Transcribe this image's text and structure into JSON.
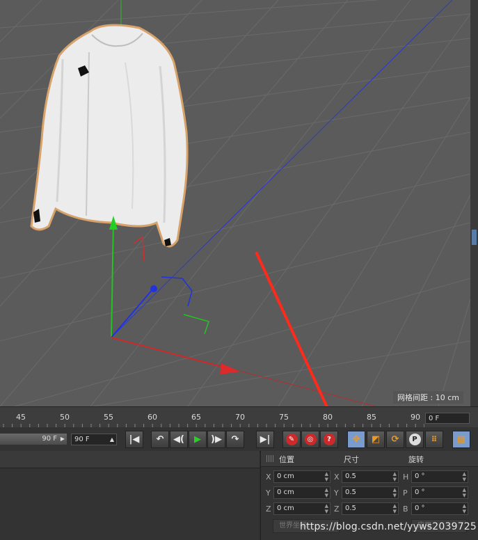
{
  "viewport": {
    "grid_spacing_label": "网格间距 : 10 cm"
  },
  "timeline": {
    "ticks": [
      "45",
      "50",
      "55",
      "60",
      "65",
      "70",
      "75",
      "80",
      "85",
      "90"
    ],
    "current_frame": "0 F",
    "range_end_label": "90 F",
    "end_frame": "90 F"
  },
  "transport": {
    "buttons": [
      {
        "name": "go-to-start-button",
        "glyph": "|◀"
      },
      {
        "name": "step-back-key-button",
        "glyph": "⟲"
      },
      {
        "name": "step-back-frame-button",
        "glyph": "◀("
      },
      {
        "name": "play-button",
        "glyph": "▶"
      },
      {
        "name": "step-forward-frame-button",
        "glyph": ")▶"
      },
      {
        "name": "step-forward-key-button",
        "glyph": "⟳"
      },
      {
        "name": "go-to-end-button",
        "glyph": "▶|"
      }
    ]
  },
  "attributes": {
    "headers": {
      "position": "位置",
      "size": "尺寸",
      "rotation": "旋转"
    },
    "rows": [
      {
        "pos_axis": "X",
        "pos_value": "0 cm",
        "size_axis": "X",
        "size_value": "0.5",
        "rot_axis": "H",
        "rot_value": "0 °"
      },
      {
        "pos_axis": "Y",
        "pos_value": "0 cm",
        "size_axis": "Y",
        "size_value": "0.5",
        "rot_axis": "P",
        "rot_value": "0 °"
      },
      {
        "pos_axis": "Z",
        "pos_value": "0 cm",
        "size_axis": "Z",
        "size_value": "0.5",
        "rot_axis": "B",
        "rot_value": "0 °"
      }
    ],
    "coord_button": "世界坐标",
    "apply_button": "应用"
  },
  "watermark": "https://blog.csdn.net/yyws2039725",
  "colors": {
    "viewport_bg": "#5b5b5b",
    "accent_blue": "#5a7da8",
    "x_axis": "#c03030",
    "y_axis": "#20c020",
    "z_axis": "#2030c8",
    "annotation_arrow": "#ff2a1a"
  }
}
